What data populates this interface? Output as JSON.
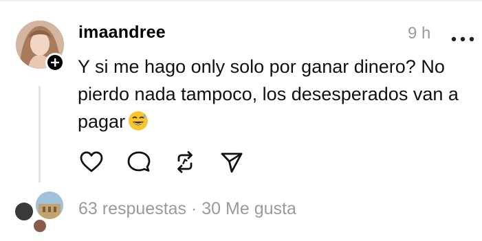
{
  "post": {
    "username": "imaandree",
    "time": "9 h",
    "text": "Y si me hago only solo por ganar dinero? No pierdo nada tampoco, los desesperados van a pagar",
    "emoji": "grinning-sweat-emoji"
  },
  "footer": {
    "replies": "63 respuestas",
    "separator": "·",
    "likes": "30 Me gusta"
  },
  "icons": {
    "more": "more-horizontal-icon",
    "like": "heart-icon",
    "reply": "comment-bubble-icon",
    "repost": "repost-icon",
    "share": "send-icon",
    "follow": "plus-icon"
  },
  "colors": {
    "muted_text": "#9a9a9a",
    "thread_line": "#e3e3e3",
    "badge": "#000000"
  }
}
